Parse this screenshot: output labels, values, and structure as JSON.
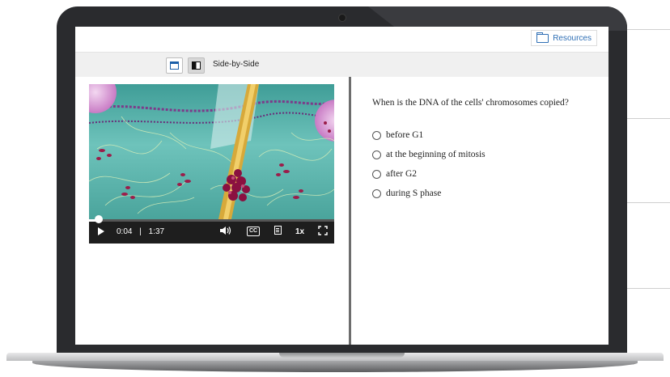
{
  "header": {
    "resources_label": "Resources"
  },
  "toolbar": {
    "layout_label": "Side-by-Side",
    "accent": "#1b5fa8"
  },
  "video_player": {
    "current_time": "0:04",
    "separator": "|",
    "duration": "1:37",
    "progress": 0.04,
    "cc_label": "CC",
    "speed_label": "1x"
  },
  "quiz": {
    "question": "When is the DNA of the cells' chromosomes copied?",
    "options": [
      {
        "label": "before G1"
      },
      {
        "label": "at the beginning of mitosis"
      },
      {
        "label": "after G2"
      },
      {
        "label": "during S phase"
      }
    ]
  },
  "icons": [
    "folder-icon",
    "full-view-icon",
    "split-view-icon",
    "play-icon",
    "volume-icon",
    "cc-icon",
    "transcript-icon",
    "fullscreen-icon"
  ]
}
